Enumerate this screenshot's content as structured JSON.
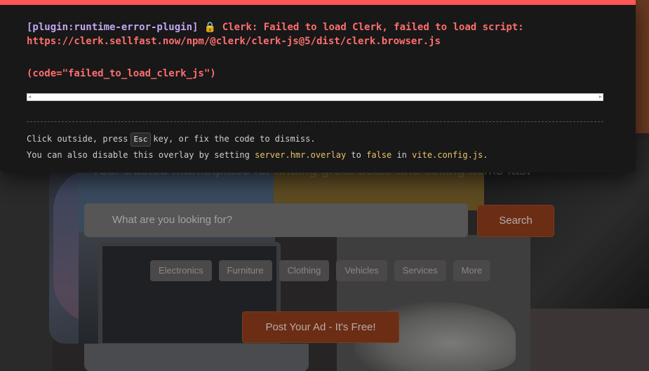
{
  "overlay": {
    "plugin": "[plugin:runtime-error-plugin]",
    "message_line1": "Clerk: Failed to load Clerk, failed to load script:",
    "message_line2": "https://clerk.sellfast.now/npm/@clerk/clerk-js@5/dist/clerk.browser.js",
    "code": "(code=\"failed_to_load_clerk_js\")",
    "tip_prefix": "Click outside, press",
    "tip_key": "Esc",
    "tip_suffix": "key, or fix the code to dismiss.",
    "tip2_prefix": "You can also disable this overlay by setting",
    "tip2_setting": "server.hmr.overlay",
    "tip2_to": "to",
    "tip2_value": "false",
    "tip2_in": "in",
    "tip2_file": "vite.config.js",
    "tip2_end": ".",
    "accent_color": "#ff5555"
  },
  "hero": {
    "tagline": "Your trusted marketplace for finding great deals and selling items fast",
    "search": {
      "placeholder": "What are you looking for?",
      "button_label": "Search"
    },
    "categories": [
      "Electronics",
      "Furniture",
      "Clothing",
      "Vehicles",
      "Services",
      "More"
    ],
    "post_ad_label": "Post Your Ad - It's Free!"
  }
}
